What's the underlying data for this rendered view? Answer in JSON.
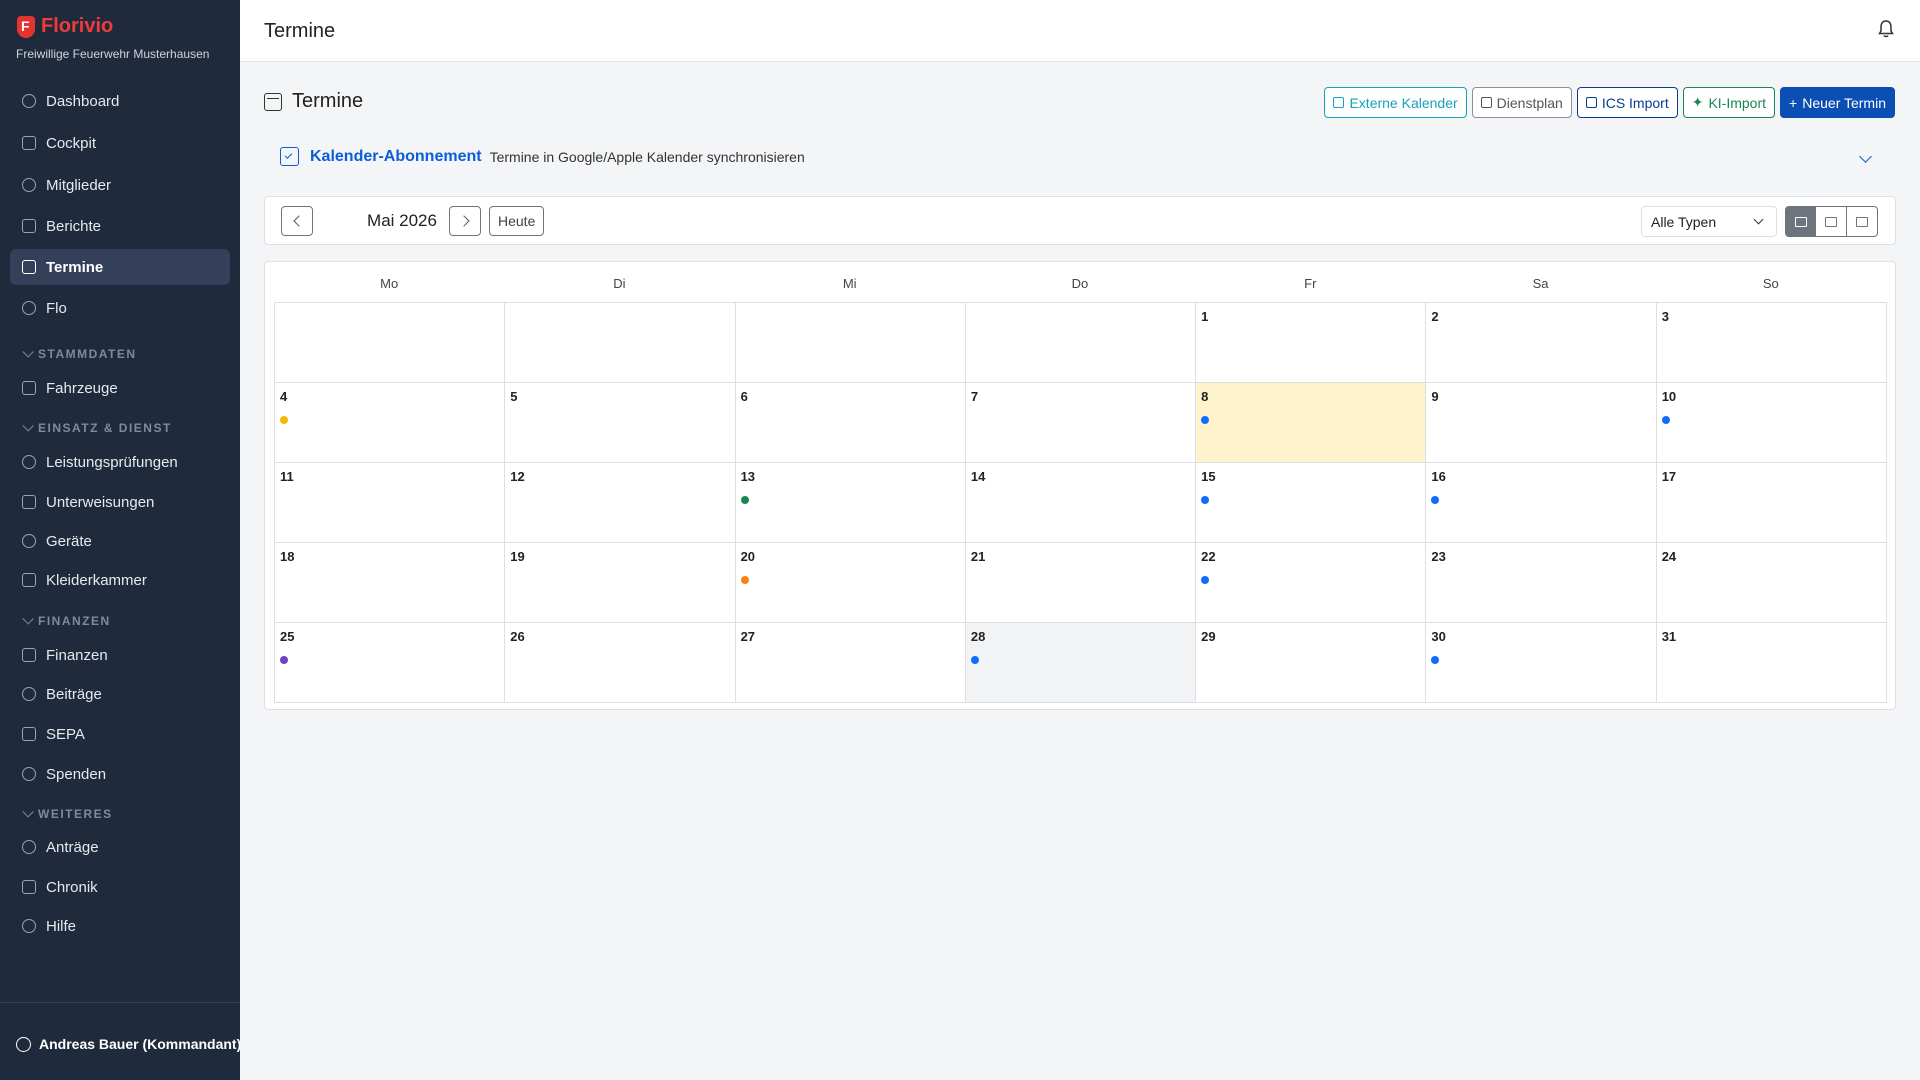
{
  "brand": {
    "name": "Florivio",
    "subtitle": "Freiwillige Feuerwehr Musterhausen"
  },
  "sidebar": {
    "items": [
      {
        "label": "Dashboard",
        "icon": "dashboard-icon"
      },
      {
        "label": "Cockpit",
        "icon": "shield-icon"
      },
      {
        "label": "Mitglieder",
        "icon": "users-icon"
      },
      {
        "label": "Berichte",
        "icon": "document-icon"
      },
      {
        "label": "Termine",
        "icon": "calendar-icon",
        "active": true
      },
      {
        "label": "Flo",
        "icon": "chat-icon"
      }
    ],
    "sections": [
      {
        "title": "STAMMDATEN",
        "items": [
          {
            "label": "Fahrzeuge",
            "icon": "truck-icon"
          }
        ]
      },
      {
        "title": "EINSATZ & DIENST",
        "items": [
          {
            "label": "Leistungsprüfungen",
            "icon": "trophy-icon"
          },
          {
            "label": "Unterweisungen",
            "icon": "mortarboard-icon"
          },
          {
            "label": "Geräte",
            "icon": "tools-icon"
          },
          {
            "label": "Kleiderkammer",
            "icon": "box-icon"
          }
        ]
      },
      {
        "title": "FINANZEN",
        "items": [
          {
            "label": "Finanzen",
            "icon": "wallet-icon"
          },
          {
            "label": "Beiträge",
            "icon": "coins-icon"
          },
          {
            "label": "SEPA",
            "icon": "bank-icon"
          },
          {
            "label": "Spenden",
            "icon": "heart-icon"
          }
        ]
      },
      {
        "title": "WEITERES",
        "items": [
          {
            "label": "Anträge",
            "icon": "person-plus-icon"
          },
          {
            "label": "Chronik",
            "icon": "journal-icon"
          },
          {
            "label": "Hilfe",
            "icon": "question-icon"
          }
        ]
      }
    ],
    "user": "Andreas Bauer (Kommandant)"
  },
  "topbar": {
    "title": "Termine"
  },
  "page": {
    "title": "Termine",
    "buttons": {
      "external": "Externe Kalender",
      "dienstplan": "Dienstplan",
      "ics": "ICS Import",
      "ki": "KI-Import",
      "new": "Neuer Termin"
    },
    "subscription": {
      "title": "Kalender-Abonnement",
      "description": "Termine in Google/Apple Kalender synchronisieren"
    }
  },
  "toolbar": {
    "month": "Mai 2026",
    "today": "Heute",
    "type_filter": "Alle Typen"
  },
  "calendar": {
    "weekdays": [
      "Mo",
      "Di",
      "Mi",
      "Do",
      "Fr",
      "Sa",
      "So"
    ],
    "today": 8,
    "shaded_day": 28,
    "event_colors": {
      "yellow": "#f5b800",
      "blue": "#0d6efd",
      "green": "#198754",
      "orange": "#fd7e14",
      "purple": "#6f42c1"
    },
    "events": {
      "4": "yellow",
      "8": "blue",
      "10": "blue",
      "13": "green",
      "15": "blue",
      "16": "blue",
      "20": "orange",
      "22": "blue",
      "25": "purple",
      "28": "blue",
      "30": "blue"
    },
    "leading_blank_days": 4,
    "days_in_month": 31
  }
}
